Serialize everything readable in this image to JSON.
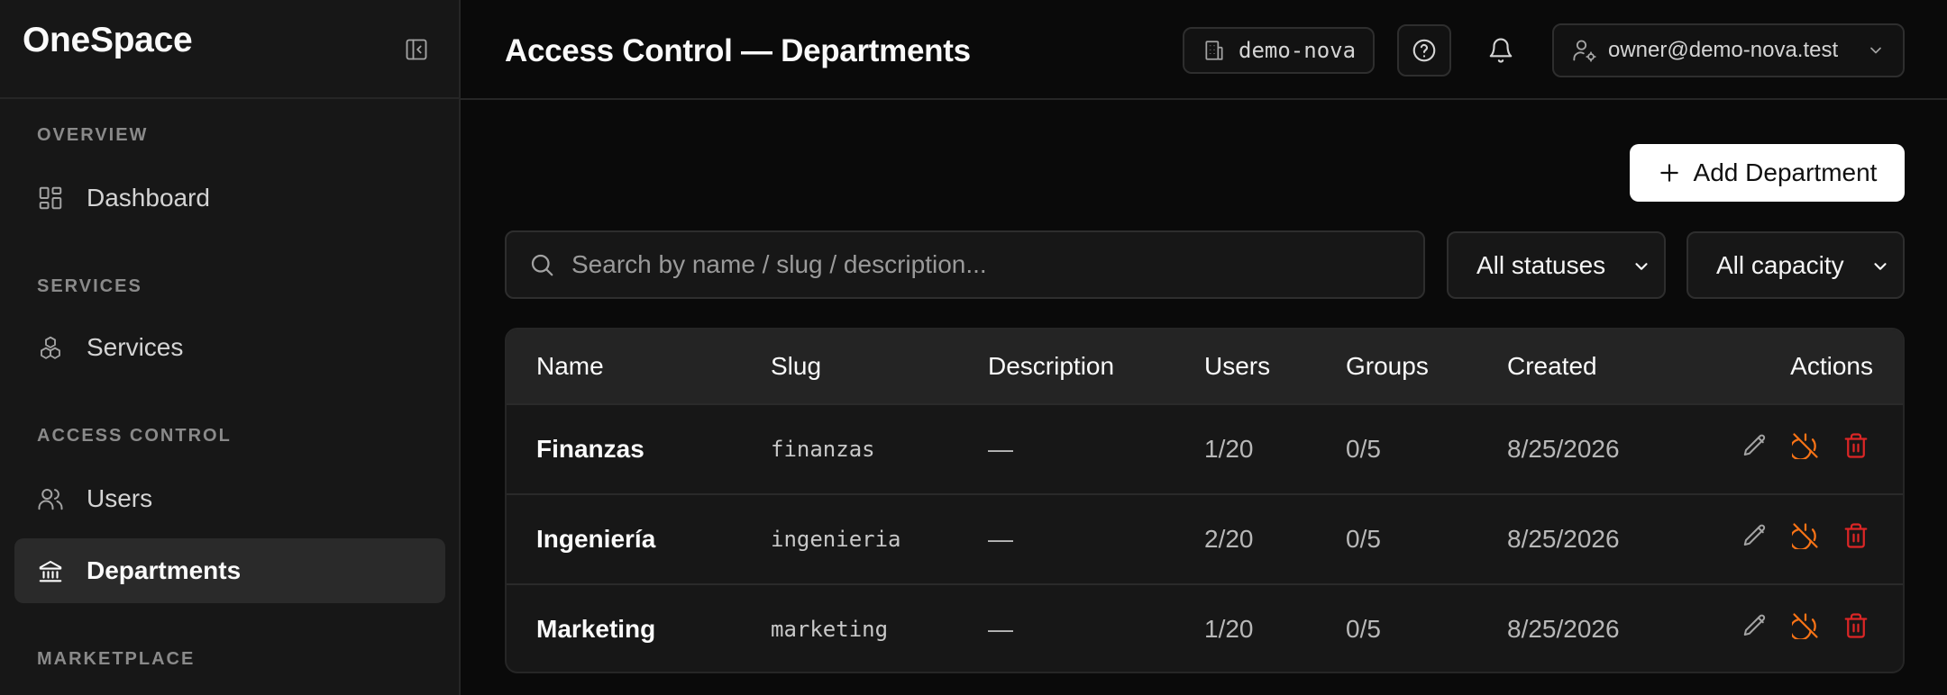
{
  "sidebar": {
    "brand": "OneSpace",
    "sections": [
      {
        "label": "OVERVIEW",
        "items": [
          {
            "label": "Dashboard",
            "icon": "dashboard-icon"
          }
        ]
      },
      {
        "label": "SERVICES",
        "items": [
          {
            "label": "Services",
            "icon": "boxes-icon"
          }
        ]
      },
      {
        "label": "ACCESS CONTROL",
        "items": [
          {
            "label": "Users",
            "icon": "users-icon"
          },
          {
            "label": "Departments",
            "icon": "building-columns-icon",
            "active": true
          }
        ]
      },
      {
        "label": "MARKETPLACE",
        "items": []
      }
    ]
  },
  "header": {
    "title": "Access Control — Departments",
    "tenant": "demo-nova",
    "user": "owner@demo-nova.test"
  },
  "toolbar": {
    "add_label": "Add Department",
    "search_placeholder": "Search by name / slug / description...",
    "status_filter": "All statuses",
    "capacity_filter": "All capacity"
  },
  "table": {
    "columns": [
      "Name",
      "Slug",
      "Description",
      "Users",
      "Groups",
      "Created",
      "Actions"
    ],
    "rows": [
      {
        "name": "Finanzas",
        "slug": "finanzas",
        "description": "—",
        "users": "1/20",
        "groups": "0/5",
        "created": "8/25/2026"
      },
      {
        "name": "Ingeniería",
        "slug": "ingenieria",
        "description": "—",
        "users": "2/20",
        "groups": "0/5",
        "created": "8/25/2026"
      },
      {
        "name": "Marketing",
        "slug": "marketing",
        "description": "—",
        "users": "1/20",
        "groups": "0/5",
        "created": "8/25/2026"
      }
    ]
  },
  "colors": {
    "background": "#0a0a0a",
    "sidebar": "#171717",
    "accent_orange": "#f97316",
    "danger_red": "#dc2626"
  }
}
